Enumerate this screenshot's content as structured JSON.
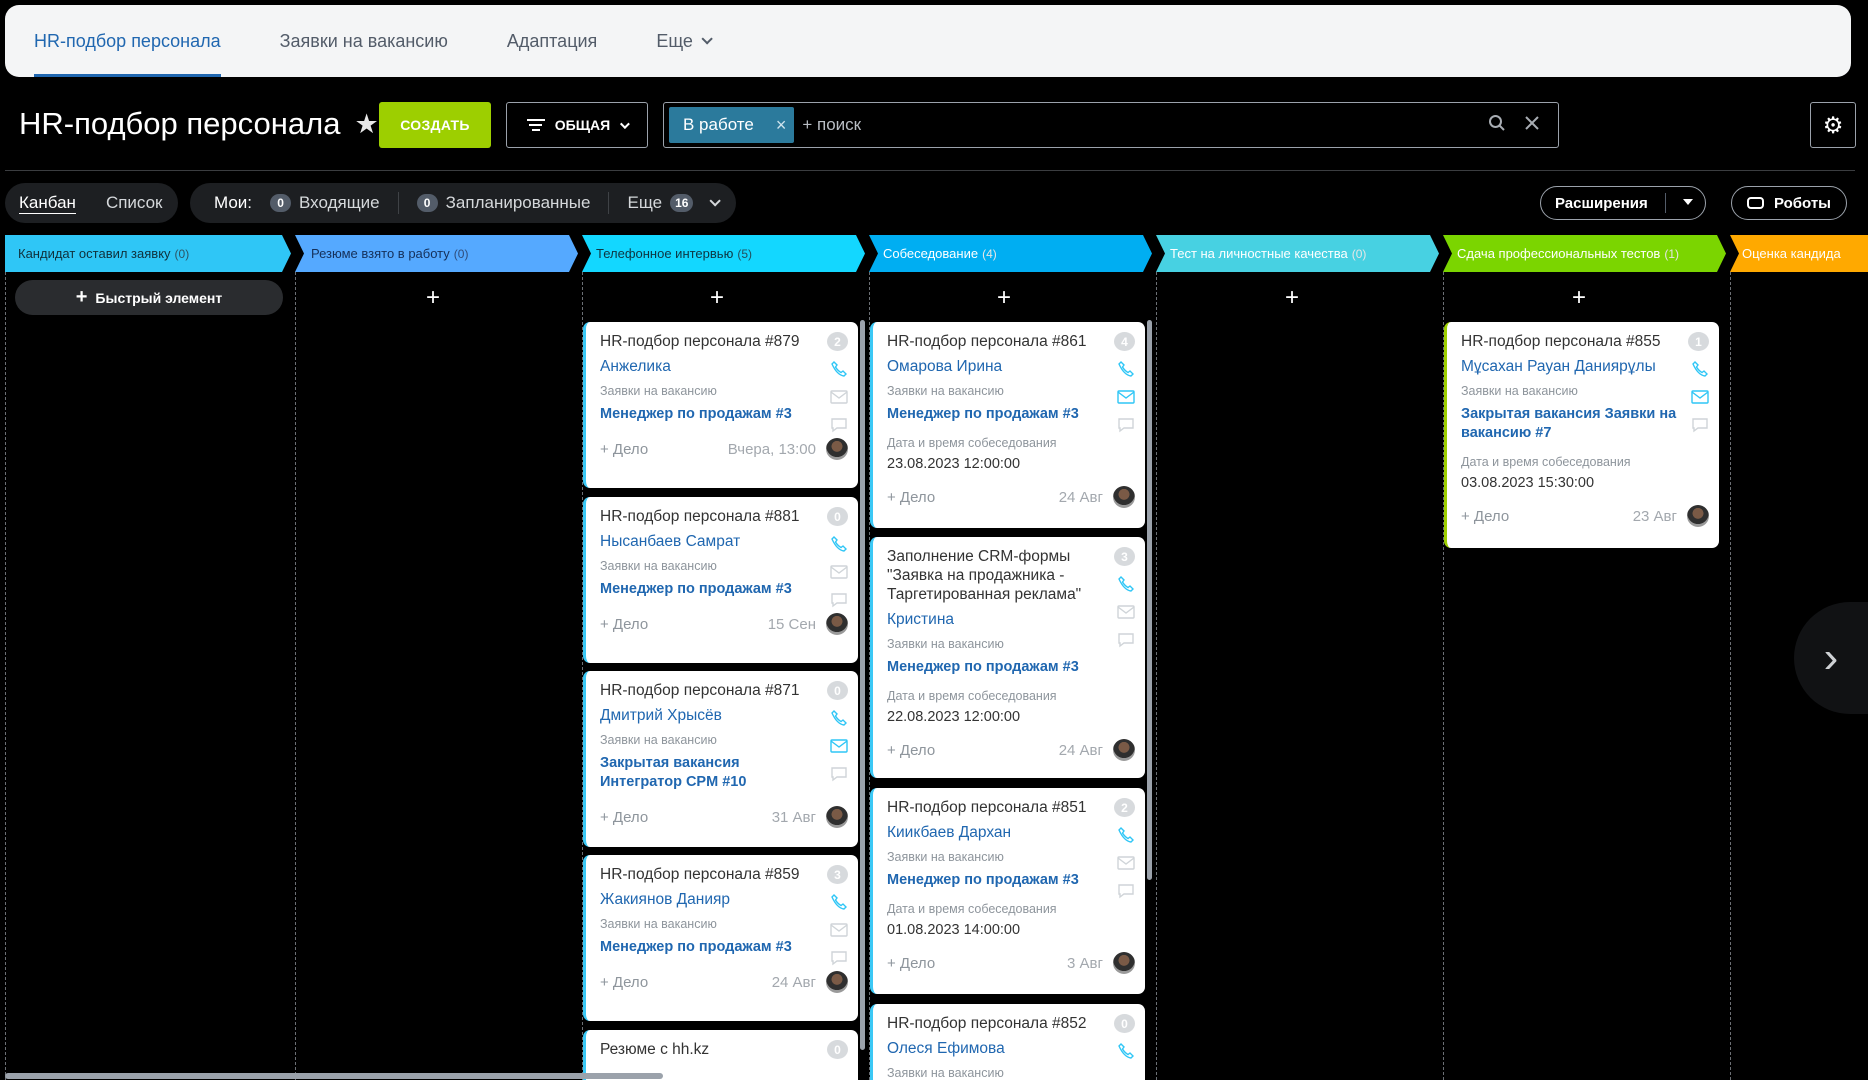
{
  "top_tabs": [
    "HR-подбор персонала",
    "Заявки на вакансию",
    "Адаптация",
    "Еще"
  ],
  "title": "HR-подбор персонала",
  "create_label": "СОЗДАТЬ",
  "filter_label": "ОБЩАЯ",
  "search": {
    "chip": "В работе",
    "placeholder": "+ поиск"
  },
  "view": {
    "kanban": "Канбан",
    "list": "Список"
  },
  "my": {
    "label": "Мои:",
    "incoming_count": "0",
    "incoming": "Входящие",
    "planned_count": "0",
    "planned": "Запланированные",
    "more": "Еще",
    "more_count": "16"
  },
  "extensions_label": "Расширения",
  "robots_label": "Роботы",
  "quick_add": "Быстрый элемент",
  "columns": [
    {
      "name": "Кандидат оставил заявку",
      "count": "(0)",
      "color": "#2fc6f6"
    },
    {
      "name": "Резюме взято в работу",
      "count": "(0)",
      "color": "#55a9ff"
    },
    {
      "name": "Телефонное интервью",
      "count": "(5)",
      "color": "#13d7ff"
    },
    {
      "name": "Собеседование",
      "count": "(4)",
      "color": "#00aef2"
    },
    {
      "name": "Тест на личностные качества",
      "count": "(0)",
      "color": "#47d1e2"
    },
    {
      "name": "Сдача профессиональных тестов",
      "count": "(1)",
      "color": "#7bd500"
    },
    {
      "name": "Оценка кандида",
      "count": "",
      "color": "#ffa900"
    }
  ],
  "cards": {
    "c879": {
      "title": "HR-подбор персонала #879",
      "name": "Анжелика",
      "sub": "Заявки на вакансию",
      "link": "Менеджер по продажам #3",
      "action": "+ Дело",
      "date": "Вчера, 13:00",
      "badge": "2"
    },
    "c881": {
      "title": "HR-подбор персонала #881",
      "name": "Нысанбаев Самрат",
      "sub": "Заявки на вакансию",
      "link": "Менеджер по продажам #3",
      "action": "+ Дело",
      "date": "15 Сен",
      "badge": "0"
    },
    "c871": {
      "title": "HR-подбор персонала #871",
      "name": "Дмитрий Хрысёв",
      "sub": "Заявки на вакансию",
      "link": "Закрытая вакансия Интегратор CPM #10",
      "action": "+ Дело",
      "date": "31 Авг",
      "badge": "0"
    },
    "c859": {
      "title": "HR-подбор персонала #859",
      "name": "Жакиянов Данияр",
      "sub": "Заявки на вакансию",
      "link": "Менеджер по продажам #3",
      "action": "+ Дело",
      "date": "24 Авг",
      "badge": "3"
    },
    "chh": {
      "title": "Резюме с hh.kz",
      "badge": "0"
    },
    "c861": {
      "title": "HR-подбор персонала #861",
      "name": "Омарова Ирина",
      "sub": "Заявки на вакансию",
      "link": "Менеджер по продажам #3",
      "dl": "Дата и время собеседования",
      "dv": "23.08.2023 12:00:00",
      "action": "+ Дело",
      "date": "24 Авг",
      "badge": "4"
    },
    "ccrm": {
      "title": "Заполнение CRM-формы \"Заявка на продажника - Таргетированная реклама\"",
      "name": "Кристина",
      "sub": "Заявки на вакансию",
      "link": "Менеджер по продажам #3",
      "dl": "Дата и время собеседования",
      "dv": "22.08.2023 12:00:00",
      "action": "+ Дело",
      "date": "24 Авг",
      "badge": "3"
    },
    "c851": {
      "title": "HR-подбор персонала #851",
      "name": "Киикбаев Дархан",
      "sub": "Заявки на вакансию",
      "link": "Менеджер по продажам #3",
      "dl": "Дата и время собеседования",
      "dv": "01.08.2023 14:00:00",
      "action": "+ Дело",
      "date": "3 Авг",
      "badge": "2"
    },
    "c852": {
      "title": "HR-подбор персонала #852",
      "name": "Олеся Ефимова",
      "sub": "Заявки на вакансию",
      "badge": "0"
    },
    "c855": {
      "title": "HR-подбор персонала #855",
      "name": "Мұсахан Рауан Даниярұлы",
      "sub": "Заявки на вакансию",
      "link": "Закрытая вакансия Заявки на вакансию #7",
      "dl": "Дата и время собеседования",
      "dv": "03.08.2023 15:30:00",
      "action": "+ Дело",
      "date": "23 Авг",
      "badge": "1"
    }
  }
}
